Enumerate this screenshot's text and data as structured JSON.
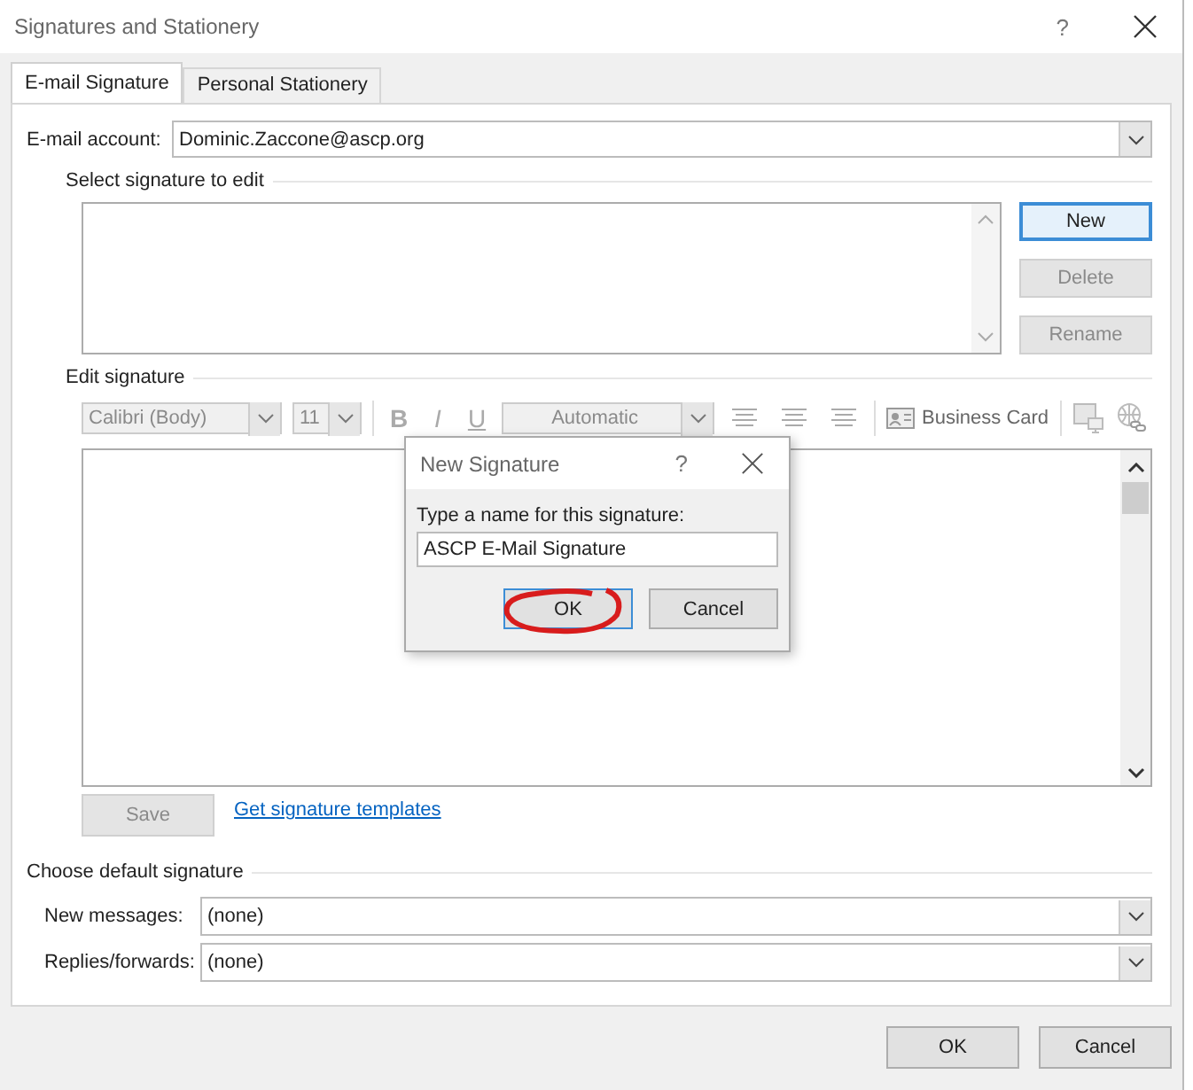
{
  "window": {
    "title": "Signatures and Stationery",
    "help": "?"
  },
  "tabs": [
    {
      "label": "E-mail Signature",
      "selected": true
    },
    {
      "label": "Personal Stationery",
      "selected": false
    }
  ],
  "account": {
    "label": "E-mail account:",
    "value": "Dominic.Zaccone@ascp.org"
  },
  "select_section": {
    "title": "Select signature to edit"
  },
  "signature_buttons": [
    {
      "label": "New",
      "disabled": false,
      "focused": true
    },
    {
      "label": "Delete",
      "disabled": true,
      "focused": false
    },
    {
      "label": "Rename",
      "disabled": true,
      "focused": false
    }
  ],
  "edit_section": {
    "title": "Edit signature"
  },
  "toolbar": {
    "font": "Calibri (Body)",
    "size": "11",
    "bold": "B",
    "italic": "I",
    "underline": "U",
    "color_label": "Automatic",
    "business_card": "Business Card"
  },
  "save_button": {
    "label": "Save",
    "disabled": true
  },
  "templates_link": "Get signature templates",
  "default_section": {
    "title": "Choose default signature",
    "rows": [
      {
        "label": "New messages:",
        "value": "(none)"
      },
      {
        "label": "Replies/forwards:",
        "value": "(none)"
      }
    ]
  },
  "footer_buttons": [
    "OK",
    "Cancel"
  ],
  "dialog": {
    "title": "New Signature",
    "help": "?",
    "prompt": "Type a name for this signature:",
    "value": "ASCP E-Mail Signature",
    "buttons": [
      {
        "label": "OK",
        "focused": true
      },
      {
        "label": "Cancel",
        "focused": false
      }
    ]
  }
}
